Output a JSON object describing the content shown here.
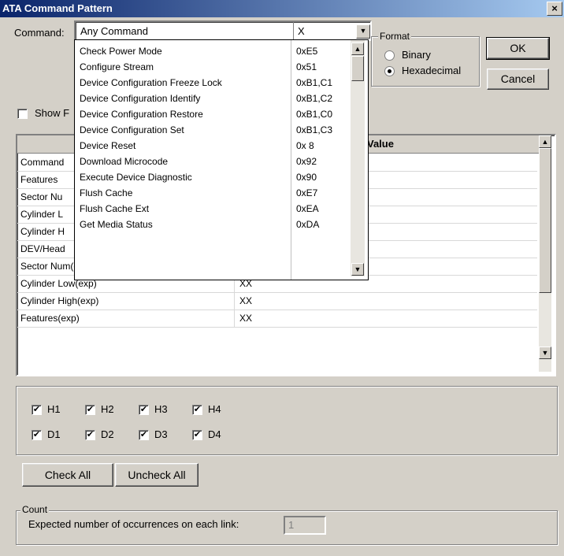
{
  "window": {
    "title": "ATA Command Pattern",
    "close": "×"
  },
  "command": {
    "label": "Command:",
    "selected_name": "Any Command",
    "selected_code": "X"
  },
  "format": {
    "label": "Format",
    "options": [
      "Binary",
      "Hexadecimal"
    ],
    "selected": "Hexadecimal"
  },
  "buttons": {
    "ok": "OK",
    "cancel": "Cancel",
    "check_all": "Check All",
    "uncheck_all": "Uncheck All"
  },
  "show_checkbox": {
    "label": "Show F",
    "checked": false
  },
  "dropdown": {
    "items": [
      {
        "name": "Check Power Mode",
        "code": "0xE5"
      },
      {
        "name": "Configure Stream",
        "code": "0x51"
      },
      {
        "name": "Device Configuration Freeze Lock",
        "code": "0xB1,C1"
      },
      {
        "name": "Device Configuration Identify",
        "code": "0xB1,C2"
      },
      {
        "name": "Device Configuration Restore",
        "code": "0xB1,C0"
      },
      {
        "name": "Device Configuration Set",
        "code": "0xB1,C3"
      },
      {
        "name": "Device Reset",
        "code": "0x 8"
      },
      {
        "name": "Download Microcode",
        "code": "0x92"
      },
      {
        "name": "Execute Device Diagnostic",
        "code": "0x90"
      },
      {
        "name": "Flush Cache",
        "code": "0xE7"
      },
      {
        "name": "Flush Cache Ext",
        "code": "0xEA"
      },
      {
        "name": "Get Media Status",
        "code": "0xDA"
      }
    ]
  },
  "grid": {
    "value_header": "Value",
    "rows": [
      {
        "field": "Command",
        "value": ""
      },
      {
        "field": "Features",
        "value": ""
      },
      {
        "field": "Sector Nu",
        "value": ""
      },
      {
        "field": "Cylinder L",
        "value": ""
      },
      {
        "field": "Cylinder H",
        "value": ""
      },
      {
        "field": "DEV/Head",
        "value": ""
      },
      {
        "field": "Sector Num(exp)",
        "value": "XX"
      },
      {
        "field": "Cylinder Low(exp)",
        "value": "XX"
      },
      {
        "field": "Cylinder High(exp)",
        "value": "XX"
      },
      {
        "field": "Features(exp)",
        "value": "XX"
      }
    ]
  },
  "links": {
    "row1": [
      {
        "label": "H1",
        "checked": true
      },
      {
        "label": "H2",
        "checked": true
      },
      {
        "label": "H3",
        "checked": true
      },
      {
        "label": "H4",
        "checked": true
      }
    ],
    "row2": [
      {
        "label": "D1",
        "checked": true
      },
      {
        "label": "D2",
        "checked": true
      },
      {
        "label": "D3",
        "checked": true
      },
      {
        "label": "D4",
        "checked": true
      }
    ],
    "check_mark": "✔"
  },
  "count": {
    "group_label": "Count",
    "prompt": "Expected number of occurrences on each link:",
    "value": "1"
  }
}
